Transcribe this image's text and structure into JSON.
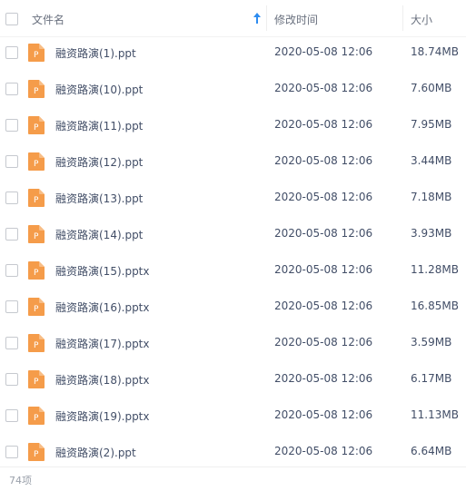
{
  "header": {
    "name_label": "文件名",
    "time_label": "修改时间",
    "size_label": "大小",
    "sort_color": "#2d8cf0"
  },
  "icon": {
    "type": "ppt-file-icon",
    "letter": "P",
    "color": "#f59c4a"
  },
  "files": [
    {
      "name": "融资路演(1).ppt",
      "modified": "2020-05-08 12:06",
      "size": "18.74MB"
    },
    {
      "name": "融资路演(10).ppt",
      "modified": "2020-05-08 12:06",
      "size": "7.60MB"
    },
    {
      "name": "融资路演(11).ppt",
      "modified": "2020-05-08 12:06",
      "size": "7.95MB"
    },
    {
      "name": "融资路演(12).ppt",
      "modified": "2020-05-08 12:06",
      "size": "3.44MB"
    },
    {
      "name": "融资路演(13).ppt",
      "modified": "2020-05-08 12:06",
      "size": "7.18MB"
    },
    {
      "name": "融资路演(14).ppt",
      "modified": "2020-05-08 12:06",
      "size": "3.93MB"
    },
    {
      "name": "融资路演(15).pptx",
      "modified": "2020-05-08 12:06",
      "size": "11.28MB"
    },
    {
      "name": "融资路演(16).pptx",
      "modified": "2020-05-08 12:06",
      "size": "16.85MB"
    },
    {
      "name": "融资路演(17).pptx",
      "modified": "2020-05-08 12:06",
      "size": "3.59MB"
    },
    {
      "name": "融资路演(18).pptx",
      "modified": "2020-05-08 12:06",
      "size": "6.17MB"
    },
    {
      "name": "融资路演(19).pptx",
      "modified": "2020-05-08 12:06",
      "size": "11.13MB"
    },
    {
      "name": "融资路演(2).ppt",
      "modified": "2020-05-08 12:06",
      "size": "6.64MB"
    }
  ],
  "footer": {
    "count": "74项"
  }
}
